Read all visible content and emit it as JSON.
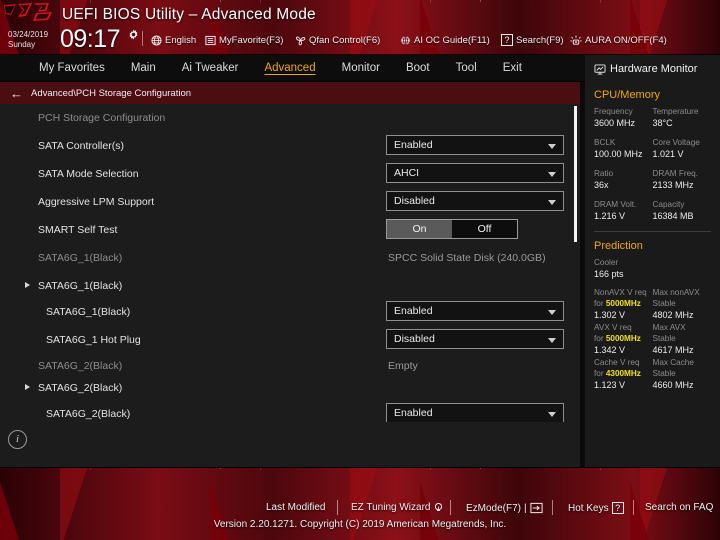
{
  "header": {
    "title": "UEFI BIOS Utility – Advanced Mode",
    "date": "03/24/2019",
    "day": "Sunday",
    "time": "09:17",
    "gear_icon": "gear-icon",
    "items": [
      {
        "label": "English",
        "icon": "globe-icon"
      },
      {
        "label": "MyFavorite(F3)",
        "icon": "list-icon"
      },
      {
        "label": "Qfan Control(F6)",
        "icon": "fan-icon"
      },
      {
        "label": "AI OC Guide(F11)",
        "icon": "brain-icon"
      },
      {
        "label": "Search(F9)",
        "icon": "question-box-icon"
      },
      {
        "label": "AURA ON/OFF(F4)",
        "icon": "aura-light-icon"
      }
    ]
  },
  "nav": {
    "tabs": [
      {
        "label": "My Favorites",
        "active": false
      },
      {
        "label": "Main",
        "active": false
      },
      {
        "label": "Ai Tweaker",
        "active": false
      },
      {
        "label": "Advanced",
        "active": true
      },
      {
        "label": "Monitor",
        "active": false
      },
      {
        "label": "Boot",
        "active": false
      },
      {
        "label": "Tool",
        "active": false
      },
      {
        "label": "Exit",
        "active": false
      }
    ]
  },
  "breadcrumb": {
    "back_icon": "back-arrow-icon",
    "path": "Advanced\\PCH Storage Configuration"
  },
  "content": {
    "section_title": "PCH Storage Configuration",
    "rows": [
      {
        "type": "section",
        "label": "PCH Storage Configuration"
      },
      {
        "type": "dropdown",
        "label": "SATA Controller(s)",
        "value": "Enabled"
      },
      {
        "type": "dropdown",
        "label": "SATA Mode Selection",
        "value": "AHCI"
      },
      {
        "type": "dropdown",
        "label": "Aggressive LPM Support",
        "value": "Disabled"
      },
      {
        "type": "toggle",
        "label": "SMART Self Test",
        "on_label": "On",
        "off_label": "Off",
        "selected": "On"
      },
      {
        "type": "info",
        "label": "SATA6G_1(Black)",
        "value": "SPCC Solid State Disk (240.0GB)"
      },
      {
        "type": "submenu",
        "label": "SATA6G_1(Black)"
      },
      {
        "type": "dropdown",
        "label": "SATA6G_1(Black)",
        "value": "Enabled",
        "indent": true
      },
      {
        "type": "dropdown",
        "label": "SATA6G_1 Hot Plug",
        "value": "Disabled",
        "indent": true
      },
      {
        "type": "info",
        "label": "SATA6G_2(Black)",
        "value": "Empty"
      },
      {
        "type": "submenu",
        "label": "SATA6G_2(Black)"
      },
      {
        "type": "dropdown",
        "label": "SATA6G_2(Black)",
        "value": "Enabled",
        "indent": true
      }
    ],
    "info_icon": "info-icon",
    "help_text": ""
  },
  "sidebar": {
    "title": "Hardware Monitor",
    "title_icon": "monitor-icon",
    "sections": [
      {
        "name": "CPU/Memory",
        "accent": "#f0a800",
        "pairs": [
          {
            "k1": "Frequency",
            "v1": "3600 MHz",
            "k2": "Temperature",
            "v2": "38°C"
          },
          {
            "k1": "BCLK",
            "v1": "100.00 MHz",
            "k2": "Core Voltage",
            "v2": "1.021 V"
          },
          {
            "k1": "Ratio",
            "v1": "36x",
            "k2": "DRAM Freq.",
            "v2": "2133 MHz"
          },
          {
            "k1": "DRAM Volt.",
            "v1": "1.216 V",
            "k2": "Capacity",
            "v2": "16384 MB"
          }
        ]
      }
    ],
    "prediction": {
      "name": "Prediction",
      "cooler_label": "Cooler",
      "cooler_value": "166 pts",
      "rows": [
        {
          "k1a": "NonAVX V req",
          "k1b_pre": "for ",
          "k1b_hi": "5000MHz",
          "v1": "1.302 V",
          "k2a": "Max nonAVX",
          "k2b": "Stable",
          "v2": "4802 MHz"
        },
        {
          "k1a": "AVX V req",
          "k1b_pre": "for ",
          "k1b_hi": "5000MHz",
          "v1": "1.342 V",
          "k2a": "Max AVX",
          "k2b": "Stable",
          "v2": "4617 MHz"
        },
        {
          "k1a": "Cache V req",
          "k1b_pre": "for ",
          "k1b_hi": "4300MHz",
          "v1": "1.123 V",
          "k2a": "Max Cache",
          "k2b": "Stable",
          "v2": "4660 MHz"
        }
      ]
    }
  },
  "footer": {
    "items": [
      {
        "label": "Last Modified",
        "icon": ""
      },
      {
        "label": "EZ Tuning Wizard",
        "icon": "bulb-icon"
      },
      {
        "label": "EzMode(F7)",
        "icon": "arrow-box-icon"
      },
      {
        "label": "Hot Keys",
        "icon": "question-box-icon"
      },
      {
        "label": "Search on FAQ",
        "icon": ""
      }
    ],
    "version": "Version 2.20.1271. Copyright (C) 2019 American Megatrends, Inc."
  },
  "colors": {
    "accent_gold": "#f0a800",
    "highlight_yellow": "#efe01c",
    "brand_red": "#8c1018",
    "content_bg": "#1c1c1c"
  }
}
